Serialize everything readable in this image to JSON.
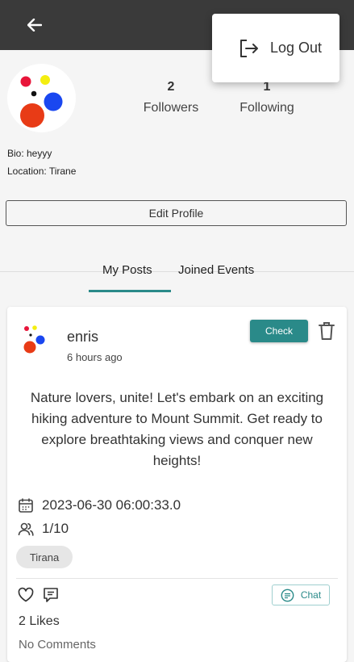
{
  "menu": {
    "logout_label": "Log Out"
  },
  "profile": {
    "followers_count": "2",
    "followers_label": "Followers",
    "following_count": "1",
    "following_label": "Following",
    "bio": "Bio: heyyy",
    "location": "Location: Tirane",
    "edit_label": "Edit Profile"
  },
  "tabs": [
    {
      "label": "My Posts",
      "active": true
    },
    {
      "label": "Joined Events",
      "active": false
    }
  ],
  "post": {
    "username": "enris",
    "time_ago": "6 hours ago",
    "check_label": "Check",
    "text": "Nature lovers, unite! Let's embark on an exciting hiking adventure to Mount Summit. Get ready to explore breathtaking views and conquer new heights!",
    "datetime": "2023-06-30 06:00:33.0",
    "participants": "1/10",
    "location_tag": "Tirana",
    "chat_label": "Chat",
    "likes": "2 Likes",
    "comments": "No Comments"
  },
  "colors": {
    "appbar": "#3a3a3a",
    "accent": "#2a8a89"
  },
  "icons": [
    "back-arrow-icon",
    "logout-icon",
    "trash-icon",
    "calendar-icon",
    "people-icon",
    "heart-icon",
    "comment-icon",
    "chat-icon"
  ]
}
